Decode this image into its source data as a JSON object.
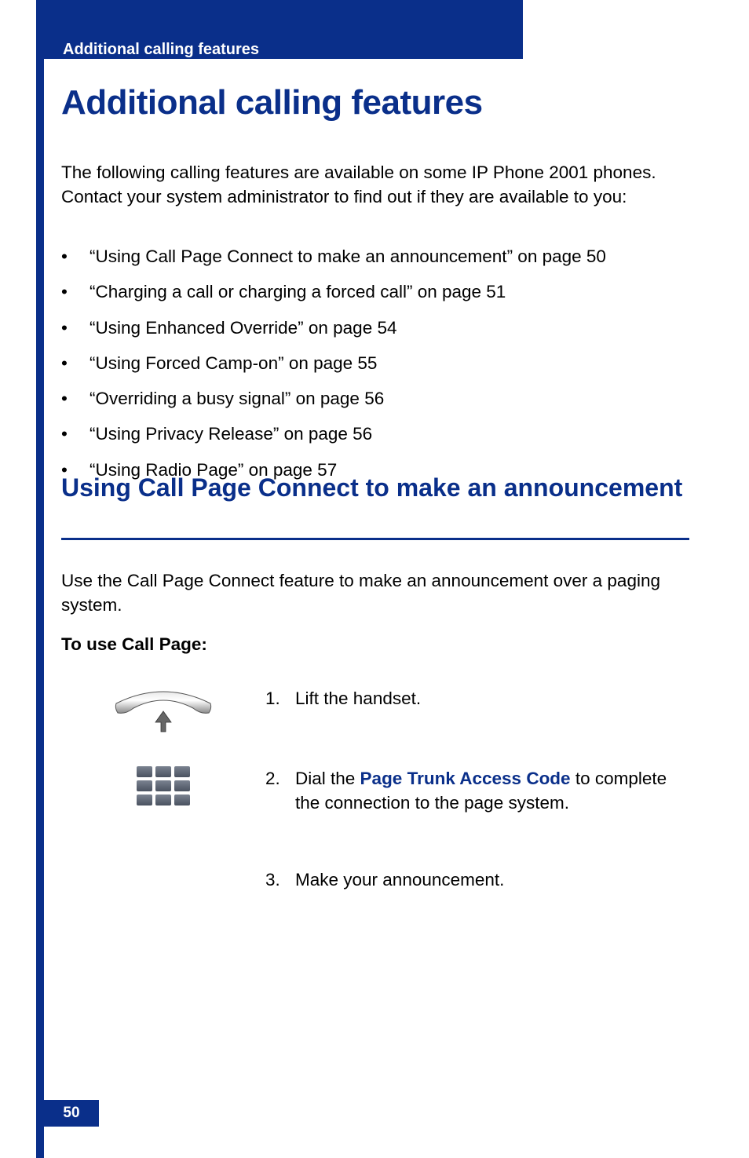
{
  "header": {
    "running_head": "Additional calling features"
  },
  "title": "Additional calling features",
  "intro": "The following calling features are available on some IP Phone 2001 phones. Contact your system administrator to find out if they are available to you:",
  "bullets": [
    "“Using Call Page Connect to make an announcement” on page 50",
    "“Charging a call or charging a forced call” on page 51",
    "“Using Enhanced Override” on page 54",
    "“Using Forced Camp-on” on page 55",
    "“Overriding a busy signal” on page 56",
    "“Using Privacy Release” on page 56",
    "“Using Radio Page” on page 57"
  ],
  "section": {
    "title": "Using Call Page Connect to make an announcement",
    "desc": "Use the Call Page Connect feature to make an announcement over a paging system.",
    "subsection": "To use Call Page:"
  },
  "steps": {
    "s1": {
      "num": "1.",
      "text": "Lift the handset."
    },
    "s2": {
      "num": "2.",
      "prefix": "Dial the ",
      "code": "Page Trunk Access Code",
      "suffix": " to complete the connection to the page system."
    },
    "s3": {
      "num": "3.",
      "text": "Make your announcement."
    }
  },
  "page_number": "50",
  "icons": {
    "handset": "handset-lift-icon",
    "keypad": "keypad-icon"
  },
  "colors": {
    "primary": "#0a2f8a"
  }
}
